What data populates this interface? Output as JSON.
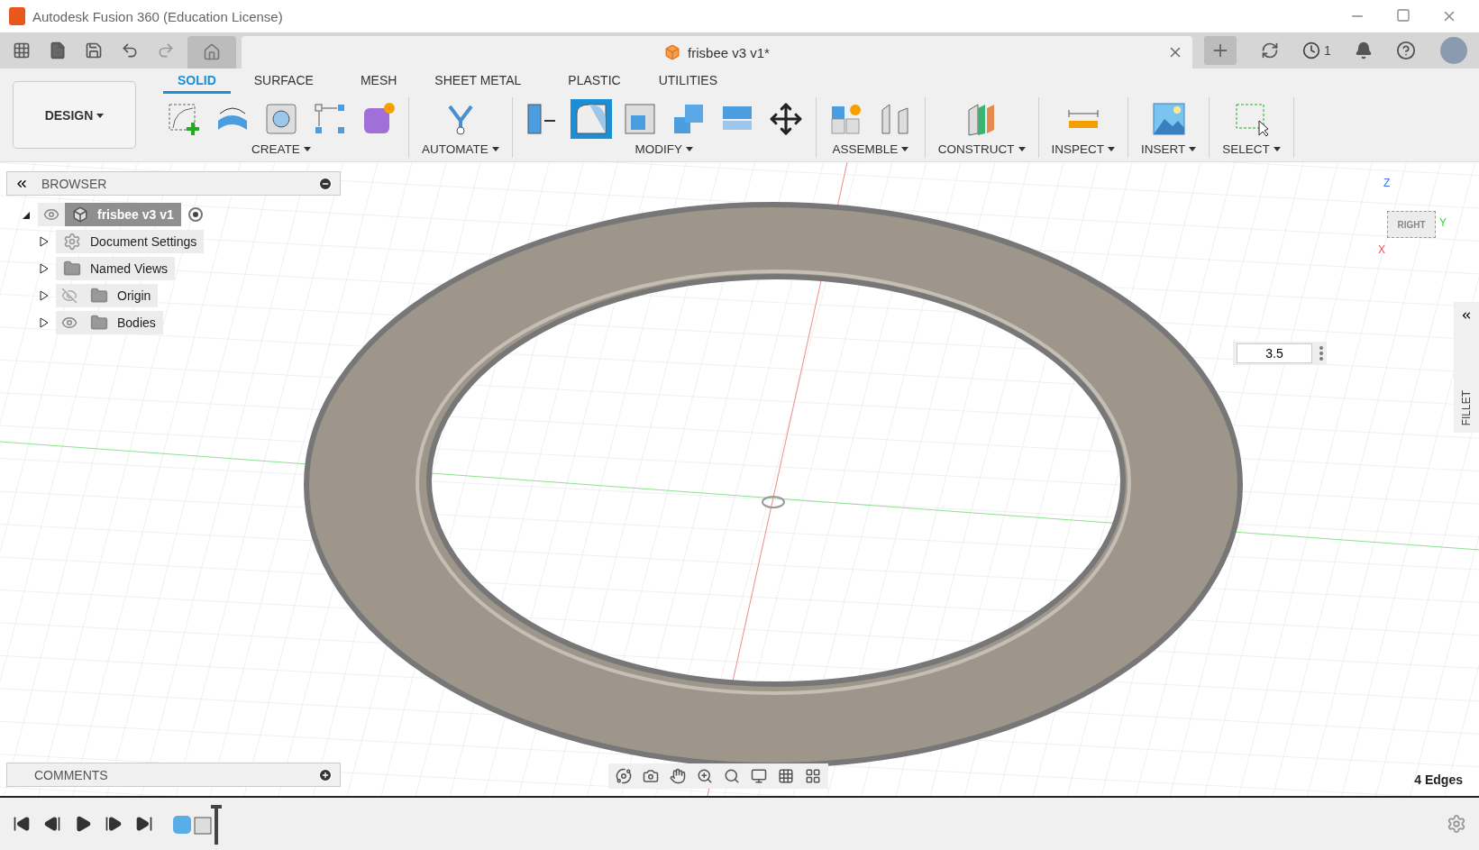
{
  "window": {
    "title": "Autodesk Fusion 360 (Education License)"
  },
  "document_tab": {
    "title": "frisbee v3 v1*"
  },
  "jobs": {
    "count": "1"
  },
  "workspace": {
    "label": "DESIGN"
  },
  "ribbon_tabs": [
    {
      "label": "SOLID",
      "selected": true
    },
    {
      "label": "SURFACE",
      "selected": false
    },
    {
      "label": "MESH",
      "selected": false
    },
    {
      "label": "SHEET METAL",
      "selected": false
    },
    {
      "label": "PLASTIC",
      "selected": false
    },
    {
      "label": "UTILITIES",
      "selected": false
    }
  ],
  "ribbon_groups": [
    {
      "label": "CREATE",
      "tools": [
        {
          "kind": "sketch",
          "selected": false
        },
        {
          "kind": "revolve",
          "selected": false
        },
        {
          "kind": "hole",
          "selected": false
        },
        {
          "kind": "pattern",
          "selected": false
        },
        {
          "kind": "form",
          "selected": false
        }
      ]
    },
    {
      "label": "AUTOMATE",
      "tools": [
        {
          "kind": "automate",
          "selected": false
        }
      ]
    },
    {
      "label": "MODIFY",
      "tools": [
        {
          "kind": "presspull",
          "selected": false
        },
        {
          "kind": "fillet",
          "selected": true
        },
        {
          "kind": "shell",
          "selected": false
        },
        {
          "kind": "combine",
          "selected": false
        },
        {
          "kind": "offset",
          "selected": false
        },
        {
          "kind": "move",
          "selected": false
        }
      ]
    },
    {
      "label": "ASSEMBLE",
      "tools": [
        {
          "kind": "component",
          "selected": false
        },
        {
          "kind": "joint",
          "selected": false
        }
      ]
    },
    {
      "label": "CONSTRUCT",
      "tools": [
        {
          "kind": "plane",
          "selected": false
        }
      ]
    },
    {
      "label": "INSPECT",
      "tools": [
        {
          "kind": "measure",
          "selected": false
        }
      ]
    },
    {
      "label": "INSERT",
      "tools": [
        {
          "kind": "image",
          "selected": false
        }
      ]
    },
    {
      "label": "SELECT",
      "tools": [
        {
          "kind": "select",
          "selected": false
        }
      ]
    }
  ],
  "browser": {
    "title": "BROWSER",
    "tree": [
      {
        "label": "frisbee v3 v1",
        "kind": "component",
        "active": true,
        "expanded": true,
        "visible": true,
        "children": [
          {
            "label": "Document Settings",
            "kind": "settings",
            "active": false,
            "expanded": false
          },
          {
            "label": "Named Views",
            "kind": "folder",
            "active": false,
            "expanded": false
          },
          {
            "label": "Origin",
            "kind": "folder",
            "active": false,
            "expanded": false,
            "visible": false
          },
          {
            "label": "Bodies",
            "kind": "folder",
            "active": false,
            "expanded": false,
            "visible": true
          }
        ]
      }
    ]
  },
  "viewcube": {
    "face": "RIGHT",
    "axes": [
      "Z",
      "Y",
      "X"
    ]
  },
  "fillet_input": {
    "value": "3.5"
  },
  "side_panel": {
    "label": "FILLET"
  },
  "comments": {
    "title": "COMMENTS"
  },
  "selection_status": "4 Edges"
}
